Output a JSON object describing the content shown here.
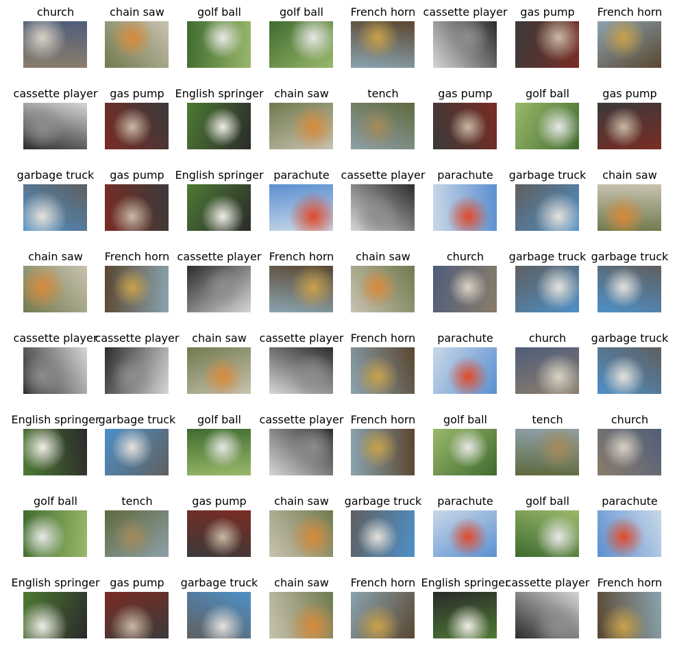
{
  "grid": {
    "rows": [
      [
        "church",
        "chain saw",
        "golf ball",
        "golf ball",
        "French horn",
        "cassette player",
        "gas pump",
        "French horn"
      ],
      [
        "cassette player",
        "gas pump",
        "English springer",
        "chain saw",
        "tench",
        "gas pump",
        "golf ball",
        "gas pump"
      ],
      [
        "garbage truck",
        "gas pump",
        "English springer",
        "parachute",
        "cassette player",
        "parachute",
        "garbage truck",
        "chain saw"
      ],
      [
        "chain saw",
        "French horn",
        "cassette player",
        "French horn",
        "chain saw",
        "church",
        "garbage truck",
        "garbage truck"
      ],
      [
        "cassette player",
        "cassette player",
        "chain saw",
        "cassette player",
        "French horn",
        "parachute",
        "church",
        "garbage truck"
      ],
      [
        "English springer",
        "garbage truck",
        "golf ball",
        "cassette player",
        "French horn",
        "golf ball",
        "tench",
        "church"
      ],
      [
        "golf ball",
        "tench",
        "gas pump",
        "chain saw",
        "garbage truck",
        "parachute",
        "golf ball",
        "parachute"
      ],
      [
        "English springer",
        "gas pump",
        "garbage truck",
        "chain saw",
        "French horn",
        "English springer",
        "cassette player",
        "French horn"
      ]
    ]
  },
  "colors": {
    "church": [
      "#8a7d6b",
      "#d9d2c4",
      "#4f5d7a"
    ],
    "chain saw": [
      "#6f7a4e",
      "#d88a3a",
      "#c9c2b0"
    ],
    "golf ball": [
      "#3f6b2f",
      "#e8e8e8",
      "#9ab86a"
    ],
    "French horn": [
      "#5a4630",
      "#c9a24a",
      "#8aa4b0"
    ],
    "cassette player": [
      "#2c2c2c",
      "#8d8d8d",
      "#d6d6d6"
    ],
    "gas pump": [
      "#7a2c24",
      "#c8b8a4",
      "#3a3a3a"
    ],
    "English springer": [
      "#4d7a34",
      "#f0eee8",
      "#2a2a2a"
    ],
    "tench": [
      "#5f6a3e",
      "#a58a5a",
      "#8ea0a8"
    ],
    "garbage truck": [
      "#4e90c8",
      "#e5e2dc",
      "#5f5f5f"
    ],
    "parachute": [
      "#5b8fd0",
      "#e04a2a",
      "#c9d8e8"
    ]
  }
}
